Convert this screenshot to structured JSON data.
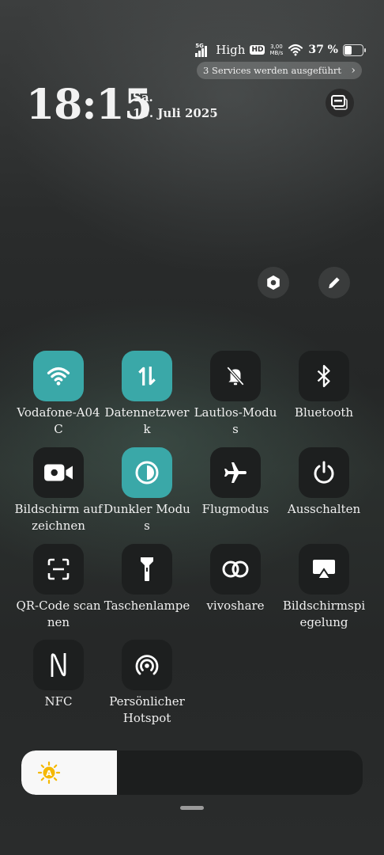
{
  "status_bar": {
    "network": "5G",
    "signal_label": "High",
    "hd_badge": "HD",
    "speed_value": "3,00",
    "speed_unit": "MB/s",
    "battery_percent": "37 %",
    "battery_level": 0.37
  },
  "services_pill": {
    "label": "3 Services werden ausgeführt",
    "chevron": "›"
  },
  "clock": {
    "time": "18:15",
    "day": "Sa.",
    "date": "19. Juli 2025"
  },
  "tiles": [
    {
      "label": "Vodafone-A04C",
      "icon": "wifi-icon",
      "active": true
    },
    {
      "label": "Datennetzwerk",
      "icon": "mobile-data-icon",
      "active": true
    },
    {
      "label": "Lautlos-Modus",
      "icon": "bell-off-icon",
      "active": false
    },
    {
      "label": "Bluetooth",
      "icon": "bluetooth-icon",
      "active": false
    },
    {
      "label": "Bildschirm aufzeichnen",
      "icon": "video-camera-icon",
      "active": false
    },
    {
      "label": "Dunkler Modus",
      "icon": "contrast-icon",
      "active": true
    },
    {
      "label": "Flugmodus",
      "icon": "airplane-icon",
      "active": false
    },
    {
      "label": "Ausschalten",
      "icon": "power-icon",
      "active": false
    },
    {
      "label": "QR-Code scannen",
      "icon": "qr-scan-icon",
      "active": false
    },
    {
      "label": "Taschenlampe",
      "icon": "flashlight-icon",
      "active": false
    },
    {
      "label": "vivoshare",
      "icon": "link-icon",
      "active": false
    },
    {
      "label": "Bildschirmspiegelung",
      "icon": "screen-mirror-icon",
      "active": false
    },
    {
      "label": "NFC",
      "icon": "nfc-icon",
      "active": false
    },
    {
      "label": "Persönlicher Hotspot",
      "icon": "hotspot-icon",
      "active": false
    }
  ],
  "brightness": {
    "level": 0.28,
    "auto_letter": "A"
  },
  "colors": {
    "accent": "#3aa8a8",
    "tile_off": "#1d1f1f",
    "sun": "#f5b800"
  }
}
